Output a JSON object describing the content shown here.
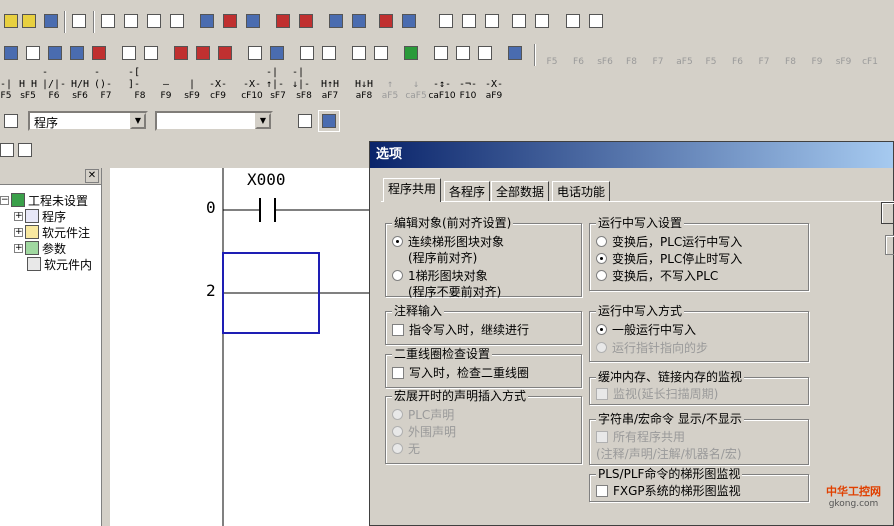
{
  "toolbar_combo": {
    "mode_value": "程序",
    "second_value": ""
  },
  "function_keys": [
    {
      "sym": "H H",
      "lbl": "sF5"
    },
    {
      "sym": "-|/|-",
      "lbl": "F6"
    },
    {
      "sym": "H/H",
      "lbl": "sF6"
    },
    {
      "sym": "-()-",
      "lbl": "F7"
    },
    {
      "sym": "-[ ]-",
      "lbl": "F8"
    },
    {
      "sym": "—",
      "lbl": "F9"
    },
    {
      "sym": "|",
      "lbl": "sF9"
    },
    {
      "sym": "-X-",
      "lbl": "cF9"
    },
    {
      "sym": "-X-",
      "lbl": "cF10"
    },
    {
      "sym": "-|↑|-",
      "lbl": "sF7"
    },
    {
      "sym": "-|↓|-",
      "lbl": "sF8"
    },
    {
      "sym": "H↑H",
      "lbl": "aF7"
    },
    {
      "sym": "H↓H",
      "lbl": "aF8"
    },
    {
      "sym": "↑",
      "lbl": "aF5"
    },
    {
      "sym": "↓",
      "lbl": "caF5"
    },
    {
      "sym": "-↕-",
      "lbl": "caF10"
    },
    {
      "sym": "-¬-",
      "lbl": "F10"
    },
    {
      "sym": "-X-",
      "lbl": "aF9"
    }
  ],
  "right_fkeys": [
    "F5",
    "F6",
    "sF6",
    "F8",
    "F7",
    "aF5",
    "F5",
    "F6",
    "F7",
    "F8",
    "F9",
    "sF9",
    "cF1"
  ],
  "tree": {
    "root": "工程未设置",
    "items": [
      "程序",
      "软元件注",
      "参数",
      "软元件内"
    ]
  },
  "ladder": {
    "contact_label": "X000",
    "step_0": "0",
    "step_2": "2"
  },
  "dialog": {
    "title": "选项",
    "tabs": [
      "程序共用",
      "各程序",
      "全部数据",
      "电话功能"
    ],
    "edit_target": {
      "title": "编辑对象(前对齐设置)",
      "opt1": "连续梯形图块对象",
      "opt1_sub": "(程序前对齐)",
      "opt2": "1梯形图块对象",
      "opt2_sub": "(程序不要前对齐)"
    },
    "comment_input": {
      "title": "注释输入",
      "check": "指令写入时，继续进行"
    },
    "double_coil": {
      "title": "二重线圈检查设置",
      "check": "写入时，检查二重线圈"
    },
    "macro_decl": {
      "title": "宏展开时的声明插入方式",
      "opt1": "PLC声明",
      "opt2": "外围声明",
      "opt3": "无"
    },
    "run_write_setting": {
      "title": "运行中写入设置",
      "opt1": "变换后，PLC运行中写入",
      "opt2": "变换后，PLC停止时写入",
      "opt3": "变换后，不写入PLC"
    },
    "run_write_method": {
      "title": "运行中写入方式",
      "opt1": "一般运行中写入",
      "opt2": "运行指针指向的步"
    },
    "buffer_monitor": {
      "title": "缓冲内存、链接内存的监视",
      "check": "监视(延长扫描周期)"
    },
    "string_macro": {
      "title": "字符串/宏命令 显示/不显示",
      "check": "所有程序共用",
      "sub": "(注释/声明/注解/机器名/宏)"
    },
    "pls_plf": {
      "title": "PLS/PLF命令的梯形图监视",
      "check": "FXGP系统的梯形图监视"
    }
  },
  "watermark": {
    "brand": "中华工控网",
    "url": "gkong.com"
  }
}
